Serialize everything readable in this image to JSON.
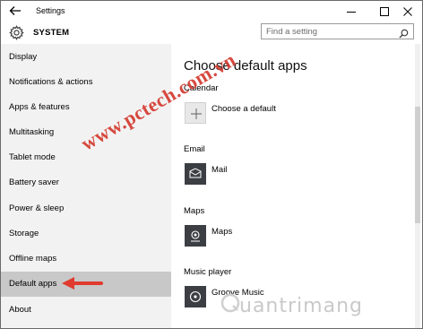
{
  "window": {
    "title": "Settings",
    "controls": {
      "minimize": "minimize-icon",
      "maximize": "maximize-icon",
      "close": "close-icon"
    }
  },
  "header": {
    "section_title": "SYSTEM",
    "search": {
      "placeholder": "Find a setting"
    }
  },
  "sidebar": {
    "items": [
      {
        "label": "Display"
      },
      {
        "label": "Notifications & actions"
      },
      {
        "label": "Apps & features"
      },
      {
        "label": "Multitasking"
      },
      {
        "label": "Tablet mode"
      },
      {
        "label": "Battery saver"
      },
      {
        "label": "Power & sleep"
      },
      {
        "label": "Storage"
      },
      {
        "label": "Offline maps"
      },
      {
        "label": "Default apps",
        "selected": true
      },
      {
        "label": "About"
      }
    ]
  },
  "main": {
    "title": "Choose default apps",
    "sections": [
      {
        "label": "Calendar",
        "app": "Choose a default",
        "icon": "plus-icon"
      },
      {
        "label": "Email",
        "app": "Mail",
        "icon": "mail-icon"
      },
      {
        "label": "Maps",
        "app": "Maps",
        "icon": "maps-icon"
      },
      {
        "label": "Music player",
        "app": "Groove Music",
        "icon": "groove-music-icon"
      }
    ]
  },
  "overlays": {
    "watermark": "www.pctech.com.vn",
    "brand": "uantrimang"
  },
  "colors": {
    "sidebar_bg": "#f2f2f2",
    "selected_bg": "#c8c8c8",
    "tile_dark": "#3b3f44",
    "watermark_red": "#d43a2f",
    "arrow_red": "#e03b2e"
  }
}
